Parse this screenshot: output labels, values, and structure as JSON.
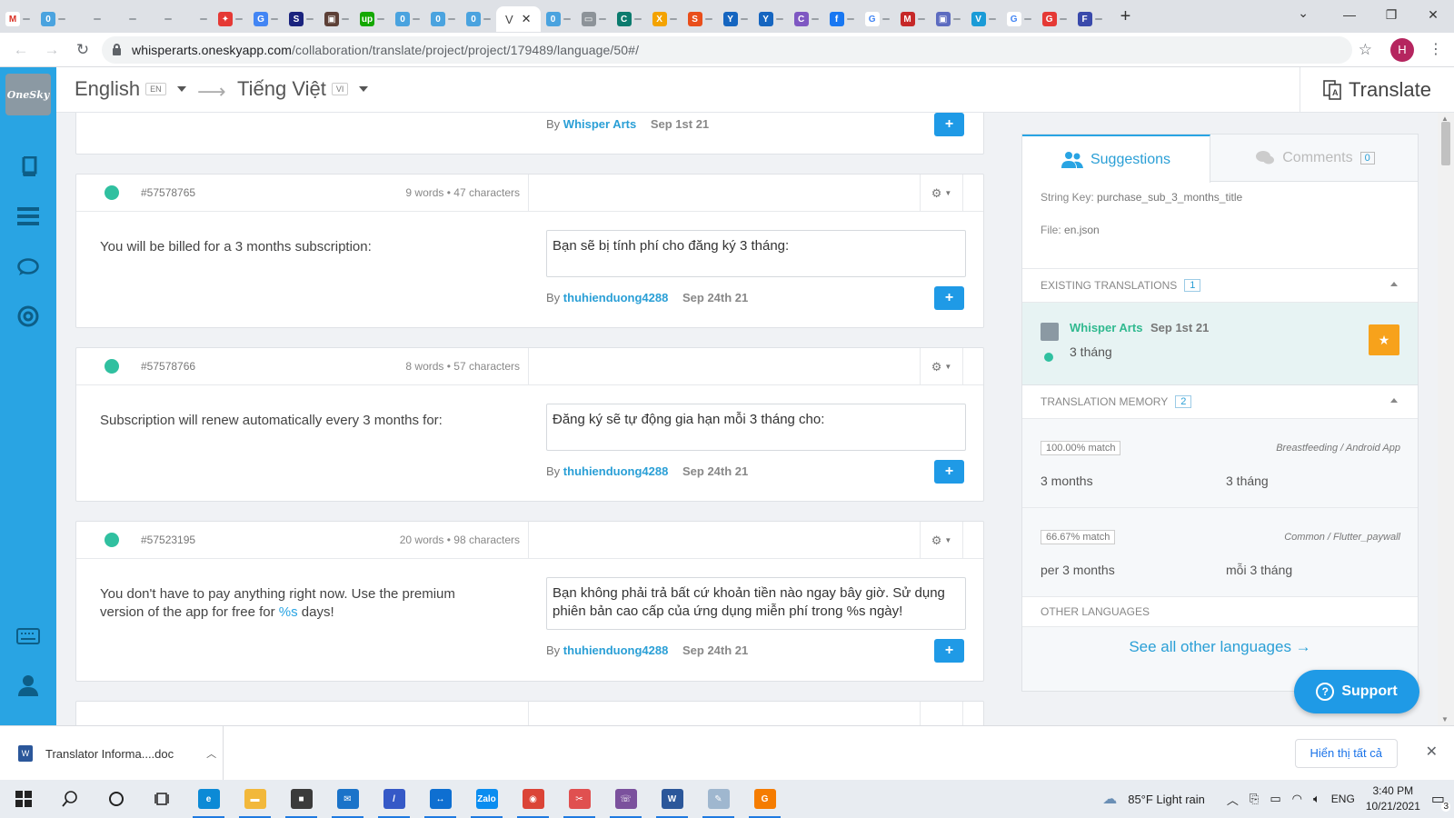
{
  "browser": {
    "tabs": [
      {
        "icon": "gmail-icon",
        "color": "#ffffff",
        "glyph": "M",
        "fg": "#d93025"
      },
      {
        "icon": "oneskyapp-icon",
        "color": "#4aa3df",
        "glyph": "0"
      },
      {
        "icon": "whisper-icon",
        "color": "#dee1e6",
        "glyph": "",
        "fg": "#999"
      },
      {
        "icon": "whisper-icon",
        "color": "#dee1e6",
        "glyph": "",
        "fg": "#999"
      },
      {
        "icon": "whisper-icon",
        "color": "#dee1e6",
        "glyph": "",
        "fg": "#999"
      },
      {
        "icon": "whisper-icon",
        "color": "#dee1e6",
        "glyph": "",
        "fg": "#999"
      },
      {
        "icon": "app-icon",
        "color": "#e53935",
        "glyph": "✦"
      },
      {
        "icon": "translate-icon",
        "color": "#4285f4",
        "glyph": "G"
      },
      {
        "icon": "s-icon",
        "color": "#1a237e",
        "glyph": "S"
      },
      {
        "icon": "image-icon",
        "color": "#5d4037",
        "glyph": "▣"
      },
      {
        "icon": "upwork-icon",
        "color": "#14a800",
        "glyph": "up"
      },
      {
        "icon": "oneskyapp-icon",
        "color": "#4aa3df",
        "glyph": "0"
      },
      {
        "icon": "oneskyapp-icon",
        "color": "#4aa3df",
        "glyph": "0"
      },
      {
        "icon": "oneskyapp-icon",
        "color": "#4aa3df",
        "glyph": "0"
      },
      {
        "icon": "oneskyapp-icon",
        "color": "#4aa3df",
        "glyph": "0"
      },
      {
        "icon": "chat-icon",
        "color": "#8d9399",
        "glyph": "▭"
      },
      {
        "icon": "c-icon",
        "color": "#0b7b6e",
        "glyph": "C"
      },
      {
        "icon": "x-icon",
        "color": "#f4a300",
        "glyph": "X"
      },
      {
        "icon": "s-icon",
        "color": "#e94e1b",
        "glyph": "S"
      },
      {
        "icon": "y-icon",
        "color": "#1565c0",
        "glyph": "Y"
      },
      {
        "icon": "y-icon",
        "color": "#1565c0",
        "glyph": "Y"
      },
      {
        "icon": "c-icon",
        "color": "#7e57c2",
        "glyph": "C"
      },
      {
        "icon": "facebook-icon",
        "color": "#1877f2",
        "glyph": "f"
      },
      {
        "icon": "google-icon",
        "color": "#ffffff",
        "glyph": "G",
        "fg": "#4285f4"
      },
      {
        "icon": "m-icon",
        "color": "#c62828",
        "glyph": "M"
      },
      {
        "icon": "image-icon",
        "color": "#5c6bc0",
        "glyph": "▣"
      },
      {
        "icon": "v-icon",
        "color": "#1a9bd7",
        "glyph": "V"
      },
      {
        "icon": "google-icon",
        "color": "#ffffff",
        "glyph": "G",
        "fg": "#4285f4"
      },
      {
        "icon": "g-icon",
        "color": "#e53935",
        "glyph": "G"
      },
      {
        "icon": "f-icon",
        "color": "#3949ab",
        "glyph": "F"
      }
    ],
    "active_tab_glyph": "V",
    "url_host": "whisperarts.oneskyapp.com",
    "url_path": "/collaboration/translate/project/project/179489/language/50#/",
    "profile_initial": "H"
  },
  "app": {
    "logo_text": "OneSky",
    "source_lang": "English",
    "source_code": "EN",
    "target_lang": "Tiếng Việt",
    "target_code": "VI",
    "translate_label": "Translate"
  },
  "strings": [
    {
      "id": "",
      "count": "",
      "source": "",
      "translation": "",
      "by_label": "By",
      "author": "Whisper Arts",
      "date": "Sep 1st 21"
    },
    {
      "id": "#57578765",
      "count": "9 words • 47 characters",
      "source": "You will be billed for a 3 months subscription:",
      "translation": "Bạn sẽ bị tính phí cho đăng ký 3 tháng:",
      "by_label": "By",
      "author": "thuhienduong4288",
      "date": "Sep 24th 21"
    },
    {
      "id": "#57578766",
      "count": "8 words • 57 characters",
      "source": "Subscription will renew automatically every 3 months for:",
      "translation": "Đăng ký sẽ tự động gia hạn mỗi 3 tháng cho:",
      "by_label": "By",
      "author": "thuhienduong4288",
      "date": "Sep 24th 21"
    },
    {
      "id": "#57523195",
      "count": "20 words • 98 characters",
      "source_pre": "You don't have to pay anything right now. Use the premium version of the app for free for ",
      "source_ph": "%s",
      "source_post": " days!",
      "translation": "Bạn không phải trả bất cứ khoản tiền nào ngay bây giờ. Sử dụng phiên bản cao cấp của ứng dụng miễn phí trong %s ngày!",
      "by_label": "By",
      "author": "thuhienduong4288",
      "date": "Sep 24th 21"
    }
  ],
  "panel": {
    "tab_suggestions": "Suggestions",
    "tab_comments": "Comments",
    "comments_count": "0",
    "string_key_label": "String Key:",
    "string_key": "purchase_sub_3_months_title",
    "file_label": "File:",
    "file": "en.json",
    "existing_title": "EXISTING TRANSLATIONS",
    "existing_count": "1",
    "existing": {
      "author": "Whisper Arts",
      "date": "Sep 1st 21",
      "text": "3 tháng"
    },
    "tm_title": "TRANSLATION MEMORY",
    "tm_count": "2",
    "tm": [
      {
        "match": "100.00% match",
        "project": "Breastfeeding / Android App",
        "source": "3 months",
        "target": "3 tháng"
      },
      {
        "match": "66.67% match",
        "project": "Common / Flutter_paywall",
        "source": "per 3 months",
        "target": "mỗi 3 tháng"
      }
    ],
    "other_title": "OTHER LANGUAGES",
    "see_all": "See all other languages →",
    "support": "Support"
  },
  "download": {
    "file": "Translator Informa....doc",
    "show_all": "Hiển thị tất cả"
  },
  "taskbar": {
    "weather": "85°F  Light rain",
    "lang": "ENG",
    "time": "3:40 PM",
    "date": "10/21/2021",
    "notif_count": "3",
    "apps": [
      {
        "name": "edge-icon",
        "color": "#0c8ad6",
        "glyph": "e"
      },
      {
        "name": "file-explorer-icon",
        "color": "#f2b83b",
        "glyph": "▬"
      },
      {
        "name": "store-icon",
        "color": "#3b3b3b",
        "glyph": "■"
      },
      {
        "name": "mail-icon",
        "color": "#1a73c9",
        "glyph": "✉"
      },
      {
        "name": "pen-app-icon",
        "color": "#3559c7",
        "glyph": "/"
      },
      {
        "name": "teamviewer-icon",
        "color": "#0e6fd1",
        "glyph": "↔"
      },
      {
        "name": "zalo-icon",
        "color": "#0a8df0",
        "glyph": "Zalo"
      },
      {
        "name": "chrome-icon",
        "color": "#db4437",
        "glyph": "◉"
      },
      {
        "name": "snipping-icon",
        "color": "#e05050",
        "glyph": "✂"
      },
      {
        "name": "viber-icon",
        "color": "#7b519d",
        "glyph": "☏"
      },
      {
        "name": "word-icon",
        "color": "#2b579a",
        "glyph": "W"
      },
      {
        "name": "paint-icon",
        "color": "#9fb7cf",
        "glyph": "✎"
      },
      {
        "name": "pdf-icon",
        "color": "#f57c00",
        "glyph": "G"
      }
    ]
  }
}
